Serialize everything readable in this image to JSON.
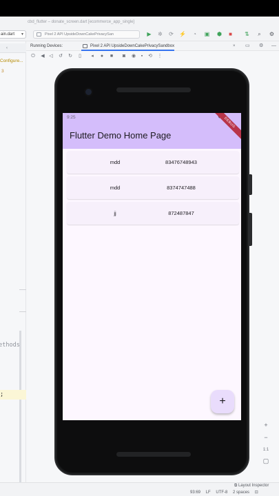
{
  "ide": {
    "window_title": "cbd_flutter – donate_screen.dart [ecommerce_app_single]",
    "toolbar": {
      "file_tab": "ain.dart",
      "device_select": "Pixel 2 API UpsideDownCakePrivacySan",
      "icons": [
        "run-icon",
        "debug-icon",
        "hot-reload-icon",
        "attach-icon",
        "profile-icon",
        "device-manager-icon",
        "stop-icon",
        "sdk-manager-icon",
        "search-icon",
        "settings-icon"
      ]
    },
    "gutter": {
      "configure_link": "Configure...",
      "line_number": "3",
      "code_fragment": "methods",
      "code_semicolon": "));"
    },
    "running_devices": {
      "label": "Running Devices:",
      "tab_label": "Pixel 2 API UpsideDownCakePrivacySandbox",
      "close": "×"
    },
    "zoom_controls": [
      "+",
      "−",
      "1:1"
    ],
    "status": {
      "layout_inspector": "Layout Inspector",
      "position": "93:69",
      "line_ending": "LF",
      "encoding": "UTF-8",
      "indent": "2 spaces"
    }
  },
  "app": {
    "status_time": "9:25",
    "debug_banner": "DEBUG",
    "title": "Flutter Demo Home Page",
    "rows": [
      {
        "name": "mdd",
        "phone": "83476748943"
      },
      {
        "name": "mdd",
        "phone": "8374747488"
      },
      {
        "name": "jj",
        "phone": "872487847"
      }
    ],
    "fab_label": "+"
  }
}
